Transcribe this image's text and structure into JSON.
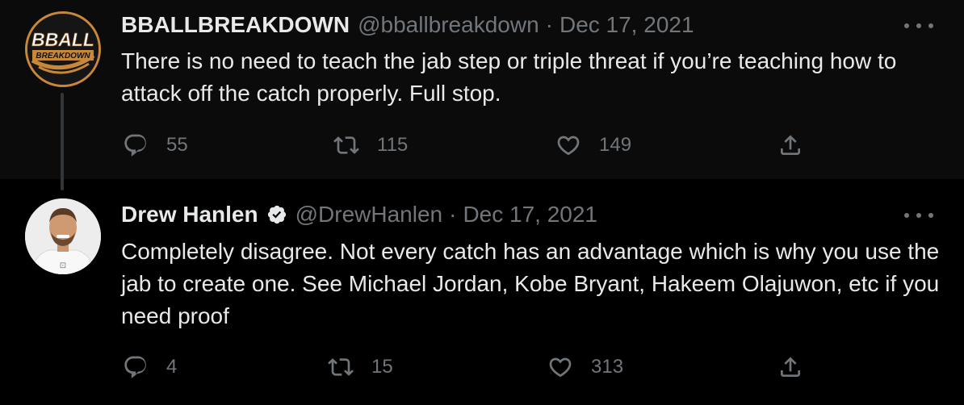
{
  "tweets": [
    {
      "display_name": "BBALLBREAKDOWN",
      "handle": "@bballbreakdown",
      "separator": "·",
      "date": "Dec 17, 2021",
      "verified": false,
      "avatar": {
        "logo_top": "BBALL",
        "logo_bottom": "BREAKDOWN"
      },
      "text": "There is no need to teach the jab step or triple threat if you’re teaching how to attack off the catch properly. Full stop.",
      "replies": "55",
      "retweets": "115",
      "likes": "149"
    },
    {
      "display_name": "Drew Hanlen",
      "handle": "@DrewHanlen",
      "separator": "·",
      "date": "Dec 17, 2021",
      "verified": true,
      "text": "Completely disagree. Not every catch has an advantage which is why you use the jab to create one. See Michael Jordan, Kobe Bryant, Hakeem Olajuwon, etc if you need proof",
      "replies": "4",
      "retweets": "15",
      "likes": "313"
    }
  ],
  "icons": {
    "reply": "reply-icon",
    "retweet": "retweet-icon",
    "like": "heart-icon",
    "share": "share-icon",
    "more": "more-icon",
    "verified": "verified-badge-icon"
  },
  "colors": {
    "background": "#000000",
    "text_primary": "#e7e9ea",
    "text_secondary": "#71767b",
    "logo_accent": "#c7883a"
  }
}
